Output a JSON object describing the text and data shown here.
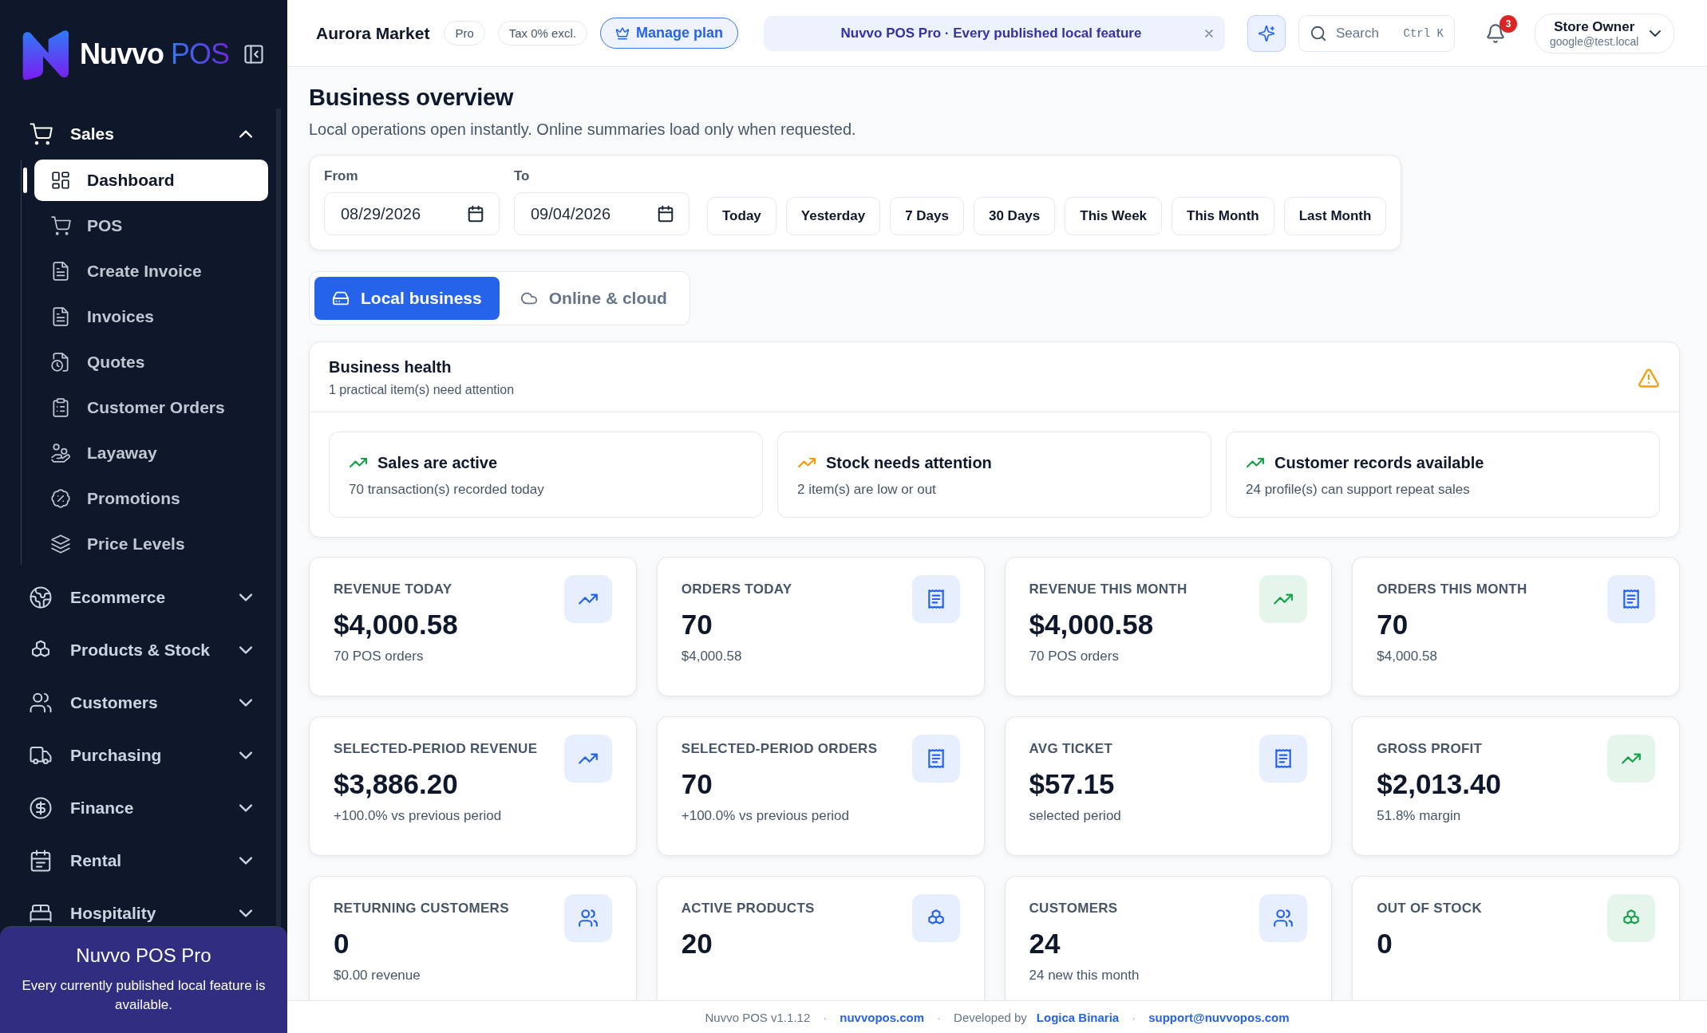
{
  "sidebar": {
    "logo": {
      "word": "Nuvvo",
      "accent": "POS"
    },
    "sections": [
      {
        "label": "Sales",
        "expanded": true,
        "children": [
          {
            "label": "Dashboard",
            "selected": true
          },
          {
            "label": "POS",
            "selected": false
          },
          {
            "label": "Create Invoice",
            "selected": false
          },
          {
            "label": "Invoices",
            "selected": false
          },
          {
            "label": "Quotes",
            "selected": false
          },
          {
            "label": "Customer Orders",
            "selected": false
          },
          {
            "label": "Layaway",
            "selected": false
          },
          {
            "label": "Promotions",
            "selected": false
          },
          {
            "label": "Price Levels",
            "selected": false
          }
        ]
      },
      {
        "label": "Ecommerce",
        "expanded": false
      },
      {
        "label": "Products & Stock",
        "expanded": false
      },
      {
        "label": "Customers",
        "expanded": false
      },
      {
        "label": "Purchasing",
        "expanded": false
      },
      {
        "label": "Finance",
        "expanded": false
      },
      {
        "label": "Rental",
        "expanded": false
      },
      {
        "label": "Hospitality",
        "expanded": false
      }
    ],
    "promo": {
      "title": "Nuvvo POS Pro",
      "text": "Every currently published local feature is available."
    }
  },
  "header": {
    "store": "Aurora Market",
    "plan_badge": "Pro",
    "tax_badge": "Tax 0% excl.",
    "manage_button": "Manage plan",
    "banner": "Nuvvo POS Pro · Every published local feature",
    "search": {
      "placeholder": "Search",
      "shortcut": "Ctrl K"
    },
    "notifications": "3",
    "user": {
      "name": "Store Owner",
      "email": "google@test.local"
    }
  },
  "page": {
    "title": "Business overview",
    "subtitle": "Local operations open instantly. Online summaries load only when requested."
  },
  "date_filter": {
    "from": {
      "label": "From",
      "value": "08/29/2026"
    },
    "to": {
      "label": "To",
      "value": "09/04/2026"
    },
    "presets": [
      "Today",
      "Yesterday",
      "7 Days",
      "30 Days",
      "This Week",
      "This Month",
      "Last Month"
    ]
  },
  "view_tabs": [
    {
      "label": "Local business",
      "selected": true
    },
    {
      "label": "Online & cloud",
      "selected": false
    }
  ],
  "health": {
    "title": "Business health",
    "subtitle": "1 practical item(s) need attention",
    "items": [
      {
        "title": "Sales are active",
        "text": "70 transaction(s) recorded today",
        "color": "#16a34a"
      },
      {
        "title": "Stock needs attention",
        "text": "2 item(s) are low or out",
        "color": "#f59e0b"
      },
      {
        "title": "Customer records available",
        "text": "24 profile(s) can support repeat sales",
        "color": "#16a34a"
      }
    ]
  },
  "stats": [
    {
      "label": "REVENUE TODAY",
      "value": "$4,000.58",
      "note": "70 POS orders",
      "kind": "revenue",
      "color": "#2563eb"
    },
    {
      "label": "ORDERS TODAY",
      "value": "70",
      "note": "$4,000.58",
      "kind": "orders",
      "color": "#2563eb"
    },
    {
      "label": "REVENUE THIS MONTH",
      "value": "$4,000.58",
      "note": "70 POS orders",
      "kind": "revenue",
      "color": "#16a34a"
    },
    {
      "label": "ORDERS THIS MONTH",
      "value": "70",
      "note": "$4,000.58",
      "kind": "orders",
      "color": "#2563eb"
    },
    {
      "label": "SELECTED-PERIOD REVENUE",
      "value": "$3,886.20",
      "note": "+100.0% vs previous period",
      "kind": "revenue",
      "color": "#2563eb"
    },
    {
      "label": "SELECTED-PERIOD ORDERS",
      "value": "70",
      "note": "+100.0% vs previous period",
      "kind": "orders",
      "color": "#2563eb"
    },
    {
      "label": "AVG TICKET",
      "value": "$57.15",
      "note": "selected period",
      "kind": "orders",
      "color": "#2563eb"
    },
    {
      "label": "GROSS PROFIT",
      "value": "$2,013.40",
      "note": "51.8% margin",
      "kind": "revenue",
      "color": "#16a34a"
    },
    {
      "label": "RETURNING CUSTOMERS",
      "value": "0",
      "note": "$0.00 revenue",
      "kind": "customers",
      "color": "#2563eb"
    },
    {
      "label": "ACTIVE PRODUCTS",
      "value": "20",
      "kind": "products",
      "color": "#2563eb"
    },
    {
      "label": "CUSTOMERS",
      "value": "24",
      "note": "24 new this month",
      "kind": "customers",
      "color": "#2563eb"
    },
    {
      "label": "OUT OF STOCK",
      "value": "0",
      "kind": "products",
      "color": "#16a34a"
    }
  ],
  "footer": {
    "separator": "·",
    "version": "Nuvvo POS v1.1.12",
    "site": "nuvvopos.com",
    "developed_by": "Developed by",
    "developer": "Logica Binaria",
    "email": "support@nuvvopos.com"
  }
}
